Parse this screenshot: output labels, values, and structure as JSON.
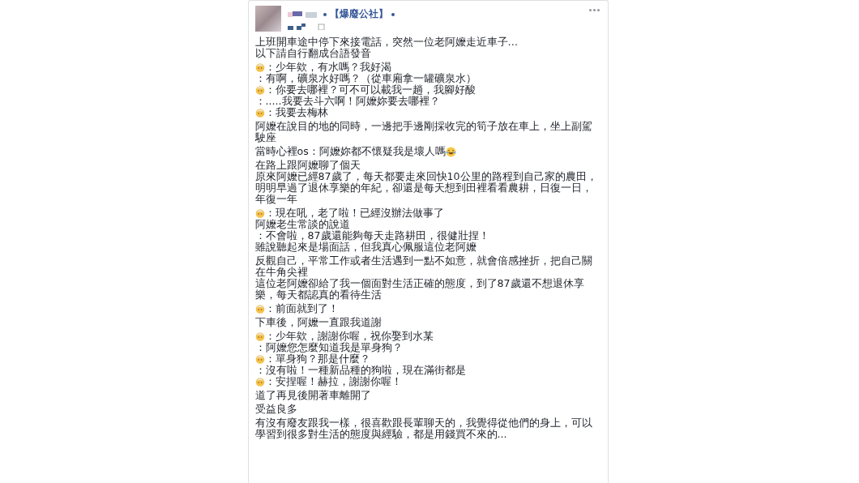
{
  "post": {
    "group_name": "【爆廢公社】",
    "paragraphs": [
      [
        {
          "kind": "plain",
          "text": "上班開車途中停下來接電話，突然一位老阿嬤走近車子…"
        },
        {
          "kind": "plain",
          "text": "以下請自行翻成台語發音"
        }
      ],
      [
        {
          "kind": "elder",
          "text": "：少年欸，有水嗎？我好渴"
        },
        {
          "kind": "plain",
          "text": "：有啊，礦泉水好嗎？（從車廂拿一罐礦泉水）"
        },
        {
          "kind": "elder",
          "text": "：你要去哪裡？可不可以載我一趟，我腳好酸"
        },
        {
          "kind": "plain",
          "text": "：.....我要去斗六啊！阿嬤妳要去哪裡？"
        },
        {
          "kind": "elder",
          "text": "：我要去梅林"
        }
      ],
      [
        {
          "kind": "plain",
          "text": "阿嬤在說目的地的同時，一邊把手邊剛採收完的筍子放在車上，坐上副駕駛座"
        }
      ],
      [
        {
          "kind": "laugh",
          "text": "當時心裡os：阿嬤妳都不懷疑我是壞人嗎"
        }
      ],
      [
        {
          "kind": "plain",
          "text": "在路上跟阿嬤聊了個天"
        },
        {
          "kind": "plain",
          "text": "原來阿嬤已經87歲了，每天都要走來回快10公里的路程到自己家的農田，明明早過了退休享樂的年紀，卻還是每天想到田裡看看農耕，日復一日，年復一年"
        }
      ],
      [
        {
          "kind": "elder",
          "text": "：現在吼，老了啦！已經沒辦法做事了"
        },
        {
          "kind": "plain",
          "text": "阿嬤老生常談的說道"
        },
        {
          "kind": "plain",
          "text": "：不會啦，87歲還能夠每天走路耕田，很健壯捏！"
        },
        {
          "kind": "plain",
          "text": "雖說聽起來是場面話，但我真心佩服這位老阿嬤"
        }
      ],
      [
        {
          "kind": "plain",
          "text": "反觀自己，平常工作或者生活遇到一點不如意，就會倍感挫折，把自己關在牛角尖裡"
        },
        {
          "kind": "plain",
          "text": "這位老阿嬤卻給了我一個面對生活正確的態度，到了87歲還不想退休享樂，每天都認真的看待生活"
        }
      ],
      [
        {
          "kind": "elder",
          "text": "：前面就到了！"
        }
      ],
      [
        {
          "kind": "plain",
          "text": "下車後，阿嬤一直跟我道謝"
        }
      ],
      [
        {
          "kind": "elder",
          "text": "：少年欸，謝謝你喔，祝你娶到水某"
        },
        {
          "kind": "plain",
          "text": "：阿嬤您怎麼知道我是單身狗？"
        },
        {
          "kind": "elder",
          "text": "：單身狗？那是什麼？"
        },
        {
          "kind": "plain",
          "text": "：沒有啦！一種新品種的狗啦，現在滿街都是"
        },
        {
          "kind": "elder",
          "text": "：安捏喔！赫拉，謝謝你喔！"
        }
      ],
      [
        {
          "kind": "plain",
          "text": "道了再見後開著車離開了"
        }
      ],
      [
        {
          "kind": "plain",
          "text": "受益良多"
        }
      ],
      [
        {
          "kind": "plain",
          "text": "有沒有廢友跟我一樣，很喜歡跟長輩聊天的，我覺得從他們的身上，可以學習到很多對生活的態度與經驗，都是用錢買不來的..."
        }
      ]
    ]
  }
}
